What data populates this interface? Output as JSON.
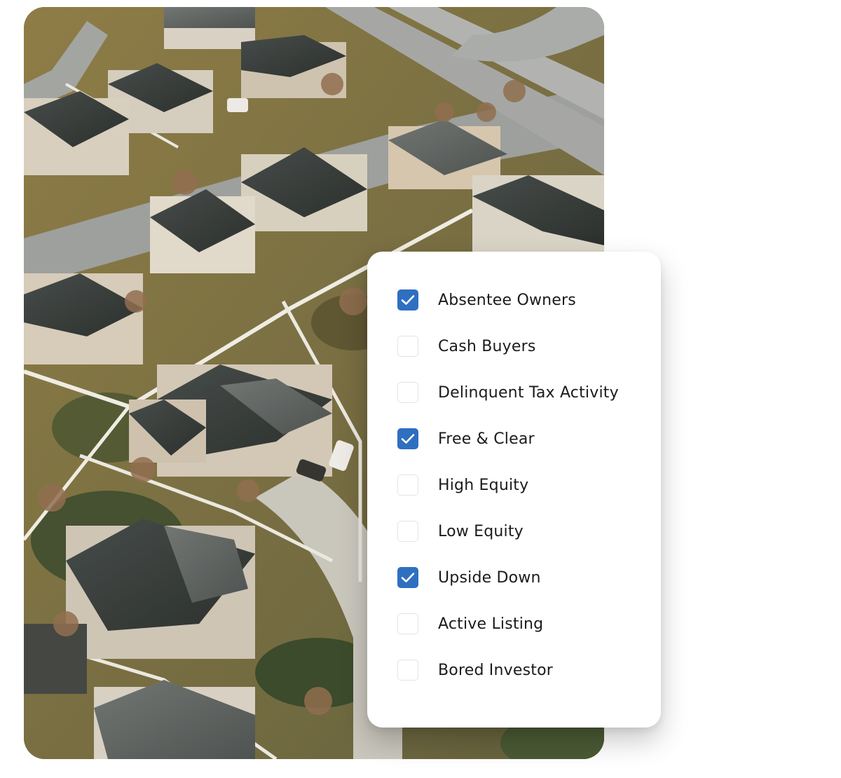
{
  "filters": {
    "accent_color": "#2f6fc0",
    "items": [
      {
        "label": "Absentee Owners",
        "checked": true
      },
      {
        "label": "Cash Buyers",
        "checked": false
      },
      {
        "label": "Delinquent Tax Activity",
        "checked": false
      },
      {
        "label": "Free & Clear",
        "checked": true
      },
      {
        "label": "High Equity",
        "checked": false
      },
      {
        "label": "Low Equity",
        "checked": false
      },
      {
        "label": "Upside Down",
        "checked": true
      },
      {
        "label": "Active Listing",
        "checked": false
      },
      {
        "label": "Bored Investor",
        "checked": false
      }
    ]
  },
  "icons": {
    "check": "check-icon"
  }
}
